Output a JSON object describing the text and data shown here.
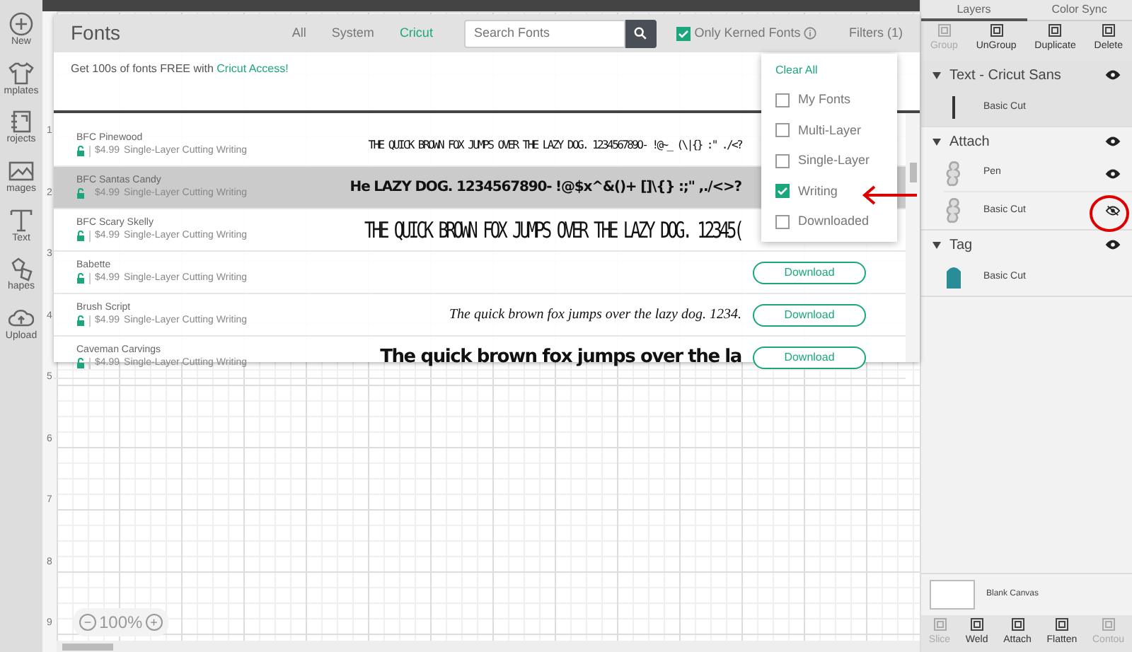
{
  "sidebar": {
    "items": [
      {
        "label": "New"
      },
      {
        "label": "mplates"
      },
      {
        "label": "rojects"
      },
      {
        "label": "mages"
      },
      {
        "label": "Text"
      },
      {
        "label": "hapes"
      },
      {
        "label": "Upload"
      }
    ]
  },
  "canvas": {
    "ruler": [
      "1",
      "2",
      "3",
      "4",
      "5",
      "6",
      "7",
      "8",
      "9"
    ],
    "zoom": "100%",
    "zoom_out": "−",
    "zoom_in": "+"
  },
  "fonts_panel": {
    "title": "Fonts",
    "tabs": [
      {
        "label": "All",
        "selected": false
      },
      {
        "label": "System",
        "selected": false
      },
      {
        "label": "Cricut",
        "selected": true
      }
    ],
    "search": {
      "placeholder": "Search Fonts"
    },
    "kerned": {
      "label": "Only Kerned Fonts",
      "checked": true
    },
    "filters": "Filters (1)",
    "promo": {
      "text": "Get 100s of fonts FREE with ",
      "link": "Cricut Access!"
    },
    "fonts": [
      {
        "name": "BFC Pinewood",
        "price": "$4.99",
        "tags": "Single-Layer Cutting Writing",
        "sample": "THE QUICK BROWN FOX JUMPS OVER THE LAZY DOG. 123456789O- !@~_ (\\|{} :\" ./<?",
        "selected": false
      },
      {
        "name": "BFC Santas Candy",
        "price": "$4.99",
        "tags": "Single-Layer Cutting Writing",
        "sample": "He LAZY DOG. 1234567890- !@$x^&()+ []\\{} :;\" ,./<>?",
        "selected": true
      },
      {
        "name": "BFC Scary Skelly",
        "price": "$4.99",
        "tags": "Single-Layer Cutting Writing",
        "sample": "THE QUICK BROWN FOX JUMPS OVER THE LAZY DOG. 12345(",
        "selected": false
      },
      {
        "name": "Babette",
        "price": "$4.99",
        "tags": "Single-Layer Cutting Writing",
        "download": "Download",
        "selected": false
      },
      {
        "name": "Brush Script",
        "price": "$4.99",
        "tags": "Single-Layer Cutting Writing",
        "sample": "The quick brown fox jumps over the lazy dog. 1234.",
        "download": "Download",
        "selected": false
      },
      {
        "name": "Caveman Carvings",
        "price": "$4.99",
        "tags": "Single-Layer Cutting Writing",
        "sample": "The quick brown fox jumps over the la",
        "download": "Download",
        "selected": false
      }
    ],
    "filter_menu": {
      "clear": "Clear All",
      "options": [
        {
          "label": "My Fonts",
          "checked": false
        },
        {
          "label": "Multi-Layer",
          "checked": false
        },
        {
          "label": "Single-Layer",
          "checked": false
        },
        {
          "label": "Writing",
          "checked": true
        },
        {
          "label": "Downloaded",
          "checked": false
        }
      ]
    }
  },
  "layers_panel": {
    "tabs": [
      {
        "label": "Layers",
        "selected": true
      },
      {
        "label": "Color Sync",
        "selected": false
      }
    ],
    "toolbar": [
      {
        "label": "Group",
        "disabled": true
      },
      {
        "label": "UnGroup",
        "disabled": false
      },
      {
        "label": "Duplicate",
        "disabled": false
      },
      {
        "label": "Delete",
        "disabled": false
      }
    ],
    "groups": [
      {
        "name": "Text - Cricut Sans",
        "selected": true,
        "visible": true,
        "children": [
          {
            "name": "Basic Cut"
          }
        ]
      },
      {
        "name": "Attach",
        "selected": false,
        "visible": true,
        "children": [
          {
            "name": "Pen",
            "visible": true
          },
          {
            "name": "Basic Cut",
            "visible": false
          }
        ]
      },
      {
        "name": "Tag",
        "selected": false,
        "visible": true,
        "children": [
          {
            "name": "Basic Cut"
          }
        ]
      }
    ],
    "canvas_label": "Blank Canvas",
    "actions": [
      {
        "label": "Slice",
        "disabled": true
      },
      {
        "label": "Weld",
        "disabled": false
      },
      {
        "label": "Attach",
        "disabled": false
      },
      {
        "label": "Flatten",
        "disabled": false
      },
      {
        "label": "Contou",
        "disabled": true
      }
    ]
  }
}
